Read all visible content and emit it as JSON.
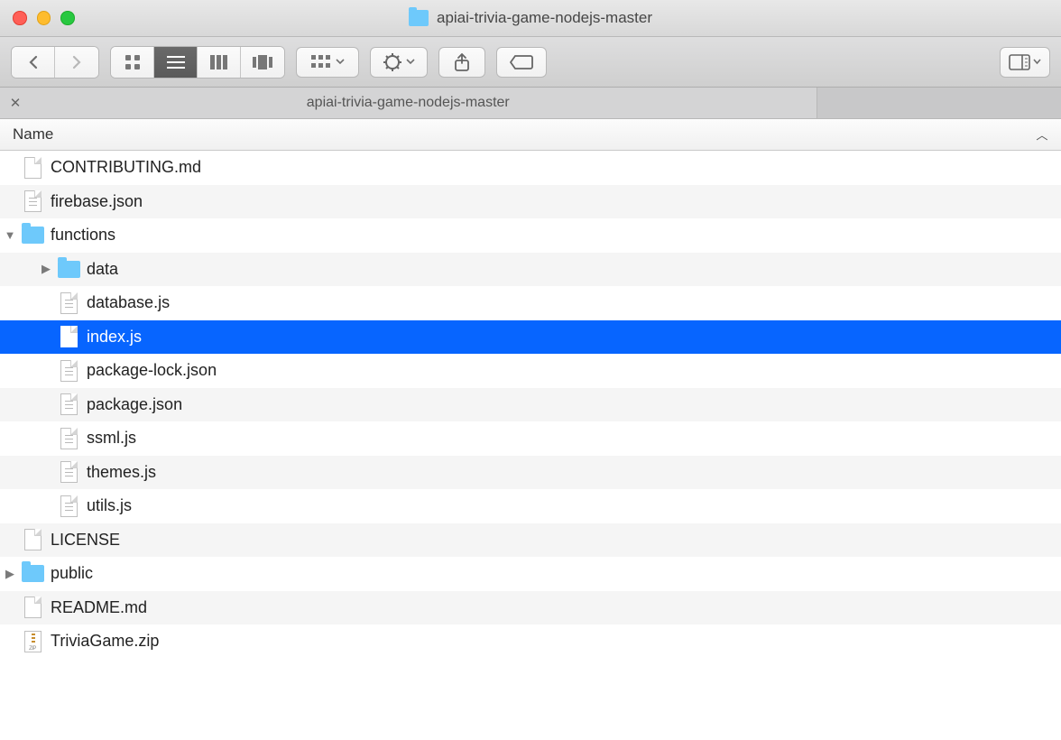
{
  "window": {
    "title": "apiai-trivia-game-nodejs-master"
  },
  "tab": {
    "label": "apiai-trivia-game-nodejs-master"
  },
  "header": {
    "name": "Name"
  },
  "items": [
    {
      "name": "CONTRIBUTING.md",
      "kind": "file",
      "indent": 0,
      "expanded": null,
      "selected": false
    },
    {
      "name": "firebase.json",
      "kind": "file_l",
      "indent": 0,
      "expanded": null,
      "selected": false
    },
    {
      "name": "functions",
      "kind": "folder",
      "indent": 0,
      "expanded": true,
      "selected": false
    },
    {
      "name": "data",
      "kind": "folder",
      "indent": 1,
      "expanded": false,
      "selected": false
    },
    {
      "name": "database.js",
      "kind": "file_l",
      "indent": 1,
      "expanded": null,
      "selected": false
    },
    {
      "name": "index.js",
      "kind": "file",
      "indent": 1,
      "expanded": null,
      "selected": true
    },
    {
      "name": "package-lock.json",
      "kind": "file_l",
      "indent": 1,
      "expanded": null,
      "selected": false
    },
    {
      "name": "package.json",
      "kind": "file_l",
      "indent": 1,
      "expanded": null,
      "selected": false
    },
    {
      "name": "ssml.js",
      "kind": "file_l",
      "indent": 1,
      "expanded": null,
      "selected": false
    },
    {
      "name": "themes.js",
      "kind": "file_l",
      "indent": 1,
      "expanded": null,
      "selected": false
    },
    {
      "name": "utils.js",
      "kind": "file_l",
      "indent": 1,
      "expanded": null,
      "selected": false
    },
    {
      "name": "LICENSE",
      "kind": "file",
      "indent": 0,
      "expanded": null,
      "selected": false
    },
    {
      "name": "public",
      "kind": "folder",
      "indent": 0,
      "expanded": false,
      "selected": false
    },
    {
      "name": "README.md",
      "kind": "file",
      "indent": 0,
      "expanded": null,
      "selected": false
    },
    {
      "name": "TriviaGame.zip",
      "kind": "zip",
      "indent": 0,
      "expanded": null,
      "selected": false
    }
  ]
}
